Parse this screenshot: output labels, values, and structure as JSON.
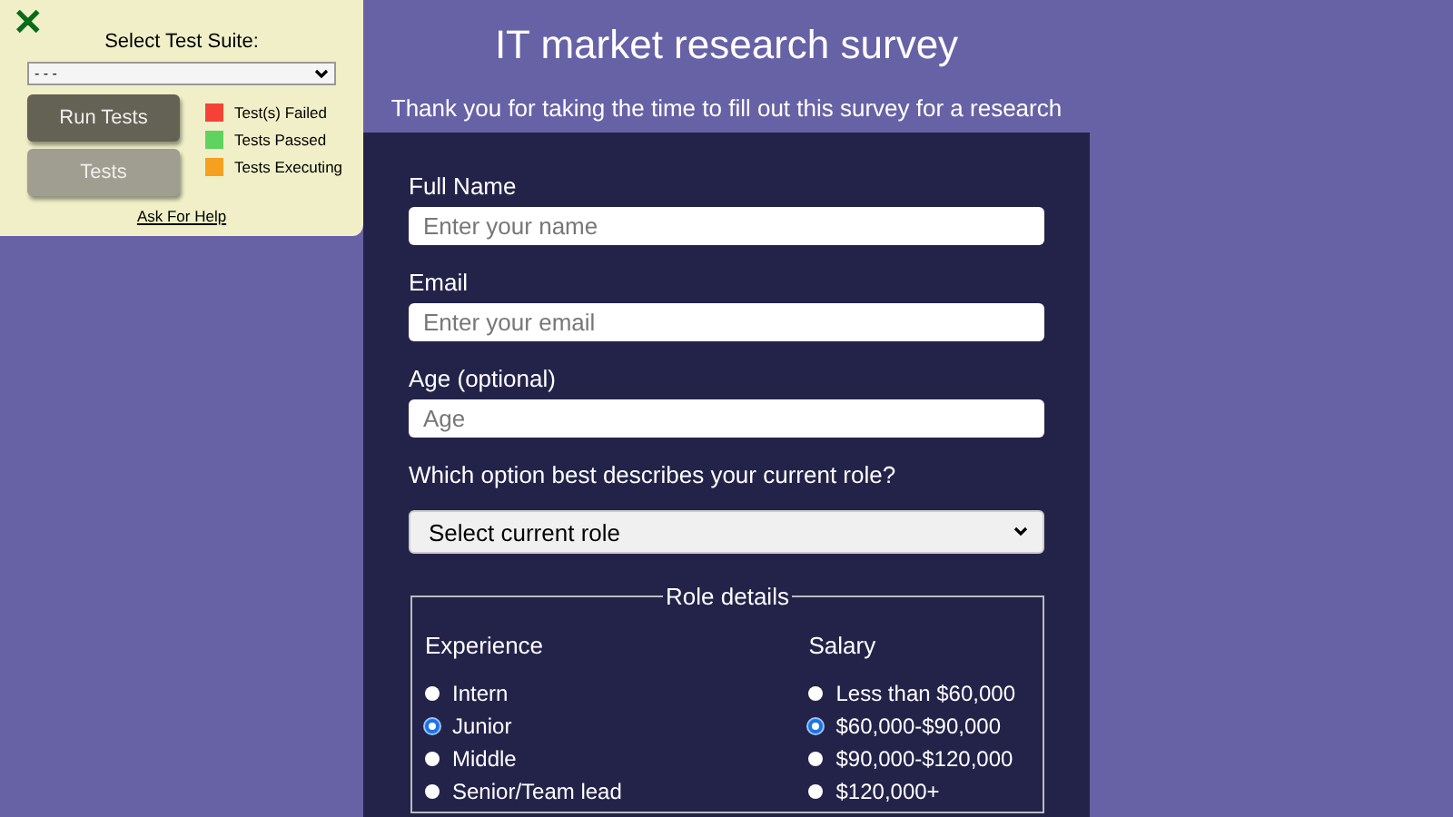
{
  "header": {
    "title": "IT market research survey",
    "subtitle": "Thank you for taking the time to fill out this survey for a research"
  },
  "form": {
    "fields": [
      {
        "label": "Full Name",
        "placeholder": "Enter your name"
      },
      {
        "label": "Email",
        "placeholder": "Enter your email"
      },
      {
        "label": "Age (optional)",
        "placeholder": "Age"
      }
    ],
    "role": {
      "label": "Which option best describes your current role?",
      "value": "Select current role"
    },
    "fieldset": {
      "legend": "Role details",
      "groups": [
        {
          "title": "Experience",
          "options": [
            {
              "label": "Intern",
              "selected": false
            },
            {
              "label": "Junior",
              "selected": true
            },
            {
              "label": "Middle",
              "selected": false
            },
            {
              "label": "Senior/Team lead",
              "selected": false
            }
          ]
        },
        {
          "title": "Salary",
          "options": [
            {
              "label": "Less than $60,000",
              "selected": false
            },
            {
              "label": "$60,000-$90,000",
              "selected": true
            },
            {
              "label": "$90,000-$120,000",
              "selected": false
            },
            {
              "label": "$120,000+",
              "selected": false
            }
          ]
        }
      ]
    }
  },
  "test_panel": {
    "close": "✕",
    "suite_label": "Select Test Suite:",
    "suite_value": "- - -",
    "buttons": [
      {
        "label": "Run Tests",
        "kind": "primary"
      },
      {
        "label": "Tests",
        "kind": "secondary"
      }
    ],
    "legend": [
      {
        "label": "Test(s) Failed",
        "color": "#f44336"
      },
      {
        "label": "Tests Passed",
        "color": "#5fd35f"
      },
      {
        "label": "Tests Executing",
        "color": "#f5a020"
      }
    ],
    "help": "Ask For Help"
  }
}
